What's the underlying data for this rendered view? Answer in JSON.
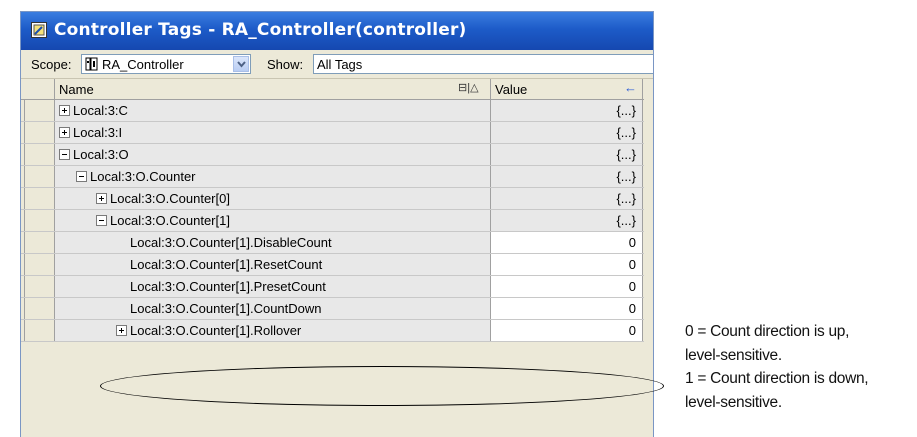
{
  "window": {
    "title": "Controller Tags - RA_Controller(controller)"
  },
  "scope": {
    "label": "Scope:",
    "value": "RA_Controller",
    "show_label": "Show:",
    "show_value": "All Tags"
  },
  "table": {
    "columns": {
      "name": "Name",
      "value": "Value"
    },
    "rows": [
      {
        "name": "Local:3:C",
        "value": "{...}",
        "expander": "plus",
        "indent": 0
      },
      {
        "name": "Local:3:I",
        "value": "{...}",
        "expander": "plus",
        "indent": 0
      },
      {
        "name": "Local:3:O",
        "value": "{...}",
        "expander": "minus",
        "indent": 0
      },
      {
        "name": "Local:3:O.Counter",
        "value": "{...}",
        "expander": "minus",
        "indent": 1
      },
      {
        "name": "Local:3:O.Counter[0]",
        "value": "{...}",
        "expander": "plus",
        "indent": 2
      },
      {
        "name": "Local:3:O.Counter[1]",
        "value": "{...}",
        "expander": "minus",
        "indent": 2
      },
      {
        "name": "Local:3:O.Counter[1].DisableCount",
        "value": "0",
        "expander": "none",
        "indent": 3
      },
      {
        "name": "Local:3:O.Counter[1].ResetCount",
        "value": "0",
        "expander": "none",
        "indent": 3
      },
      {
        "name": "Local:3:O.Counter[1].PresetCount",
        "value": "0",
        "expander": "none",
        "indent": 3
      },
      {
        "name": "Local:3:O.Counter[1].CountDown",
        "value": "0",
        "expander": "none",
        "indent": 3
      },
      {
        "name": "Local:3:O.Counter[1].Rollover",
        "value": "0",
        "expander": "plus",
        "indent": 3
      }
    ]
  },
  "annotation": {
    "line1": "0 = Count direction is up,",
    "line2": "level-sensitive.",
    "line3": "1 = Count direction is down,",
    "line4": "level-sensitive."
  }
}
